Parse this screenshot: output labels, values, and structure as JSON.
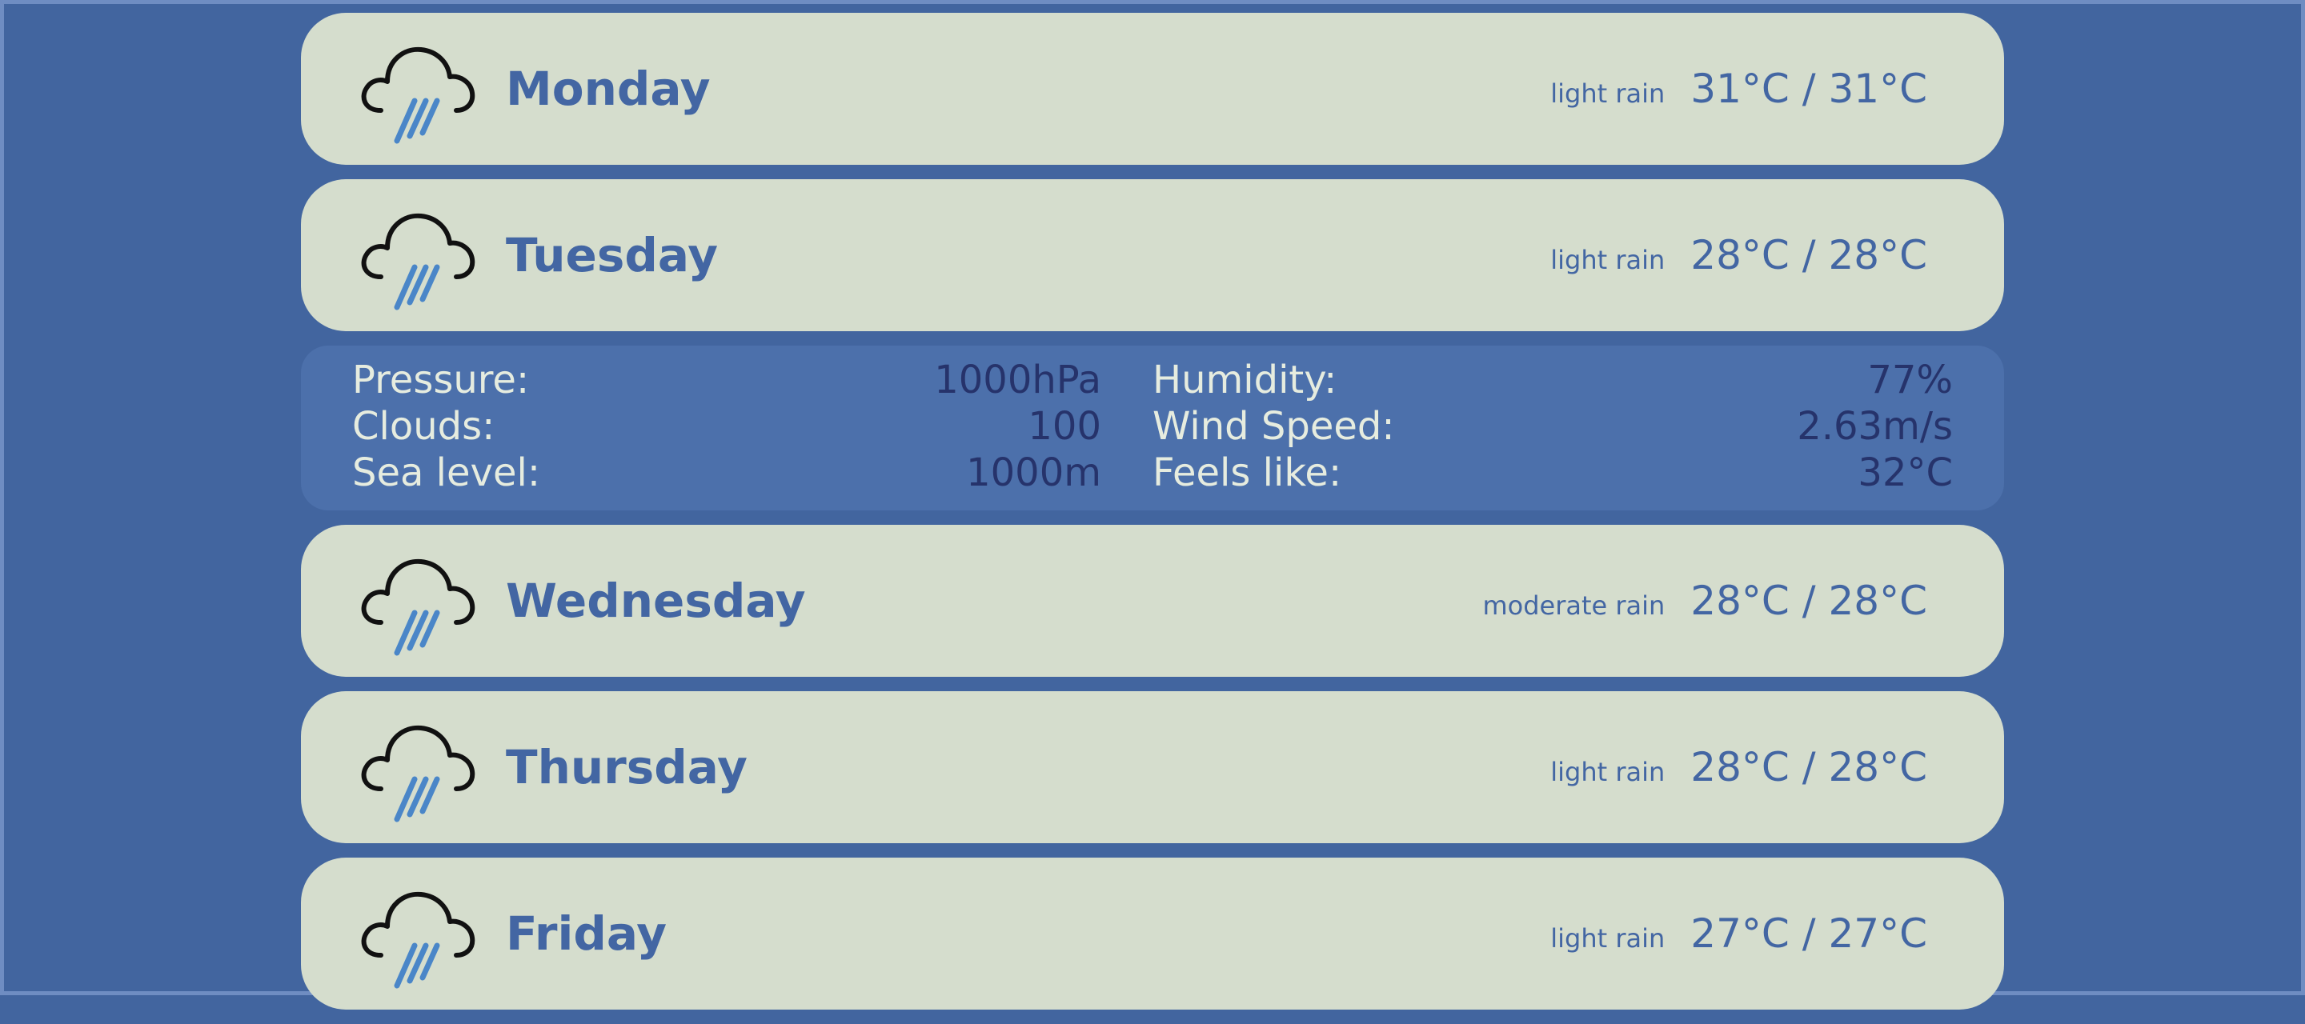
{
  "forecast": [
    {
      "day": "Monday",
      "description": "light rain",
      "temp": "31°C / 31°C",
      "icon": "rain-cloud-icon"
    },
    {
      "day": "Tuesday",
      "description": "light rain",
      "temp": "28°C / 28°C",
      "icon": "rain-cloud-icon"
    },
    {
      "day": "Wednesday",
      "description": "moderate rain",
      "temp": "28°C / 28°C",
      "icon": "rain-cloud-icon"
    },
    {
      "day": "Thursday",
      "description": "light rain",
      "temp": "28°C / 28°C",
      "icon": "rain-cloud-icon"
    },
    {
      "day": "Friday",
      "description": "light rain",
      "temp": "27°C / 27°C",
      "icon": "rain-cloud-icon"
    }
  ],
  "details": {
    "pressure_label": "Pressure:",
    "pressure_value": "1000hPa",
    "clouds_label": "Clouds:",
    "clouds_value": "100",
    "sea_level_label": "Sea level:",
    "sea_level_value": "1000m",
    "humidity_label": "Humidity:",
    "humidity_value": "77%",
    "wind_speed_label": "Wind Speed:",
    "wind_speed_value": "2.63m/s",
    "feels_like_label": "Feels like:",
    "feels_like_value": "32°C"
  },
  "colors": {
    "background": "#42659f",
    "card": "#d5ddcd",
    "accent_text": "#4366a3",
    "details_panel": "#4c70ab",
    "rain": "#4a86c8"
  }
}
